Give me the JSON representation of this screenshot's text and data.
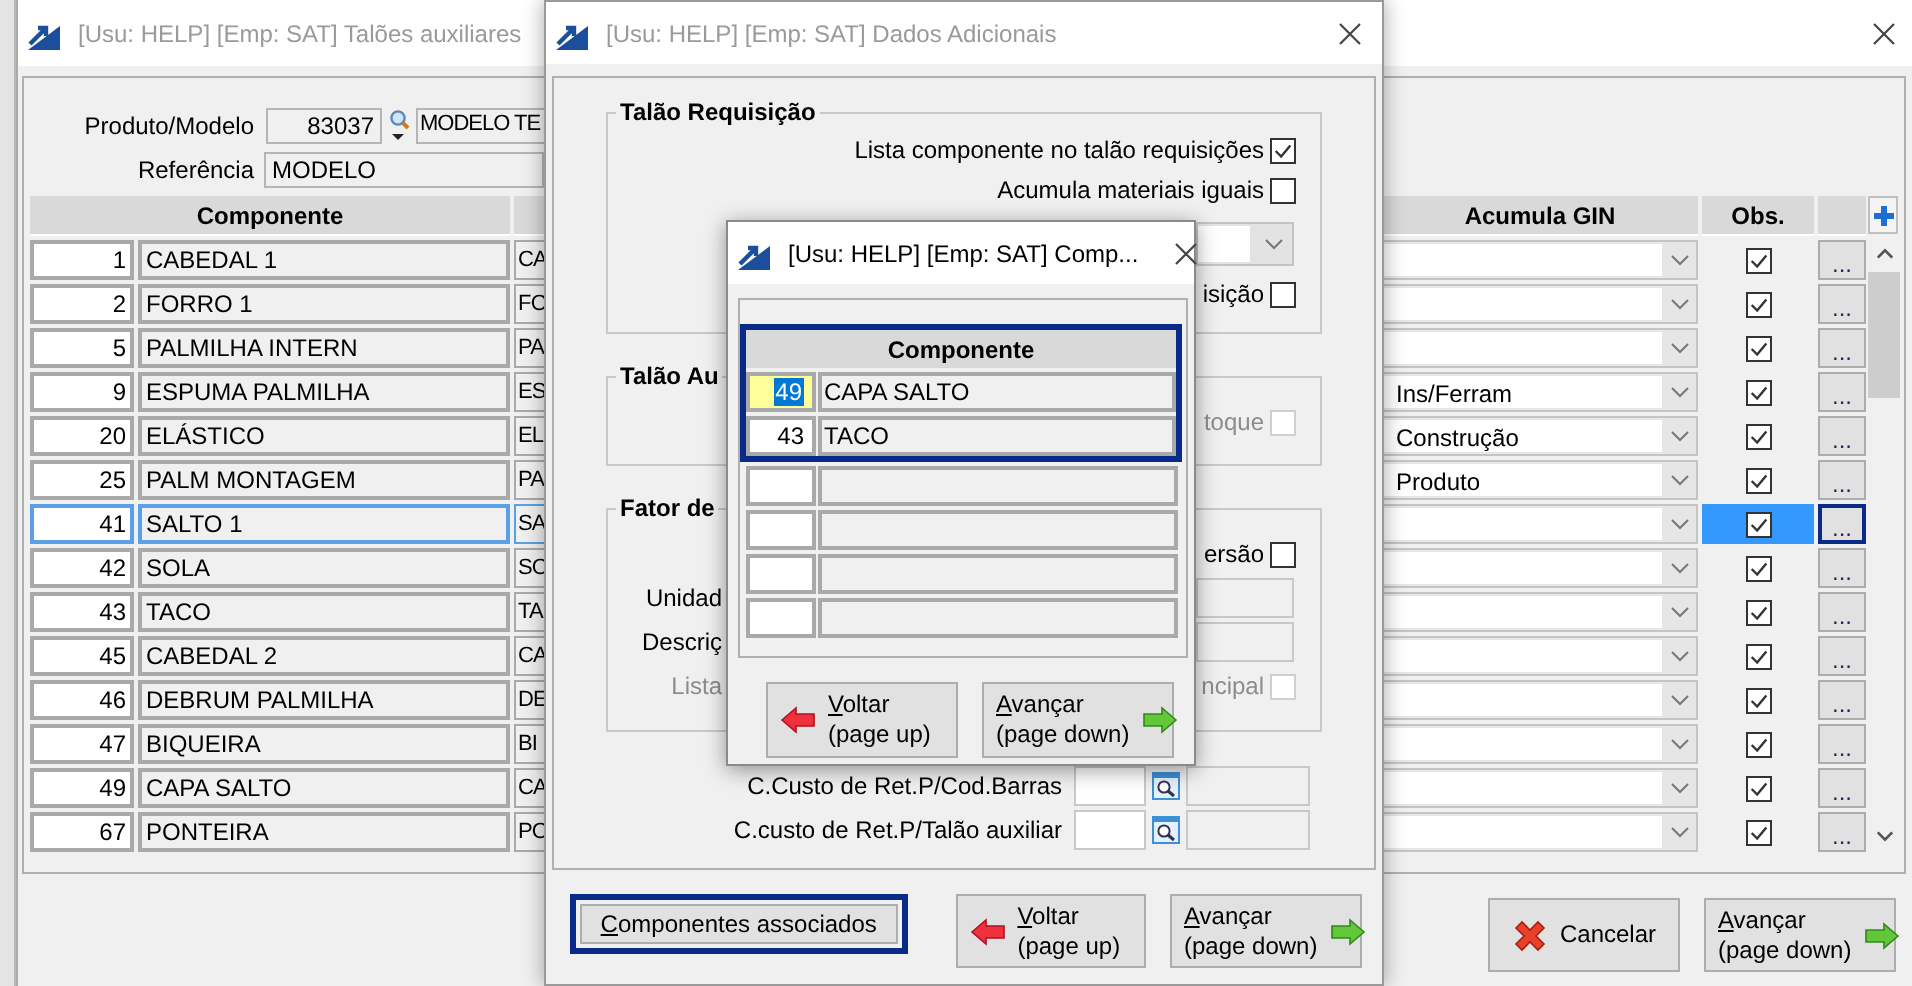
{
  "main_window": {
    "title": "[Usu: HELP] [Emp: SAT] Talões auxiliares",
    "active": false,
    "product": {
      "label": "Produto/Modelo",
      "code": "83037",
      "description": "MODELO TE"
    },
    "reference": {
      "label": "Referência",
      "value": "MODELO"
    },
    "table": {
      "columns": [
        "Componente",
        "Acumula GIN",
        "Obs."
      ],
      "rows": [
        {
          "code": "1",
          "name": "CABEDAL 1",
          "column_3": "CA",
          "obs": true,
          "button": "...",
          "selected": false
        },
        {
          "code": "2",
          "name": "FORRO 1",
          "column_3": "FO",
          "obs": true,
          "button": "...",
          "selected": false
        },
        {
          "code": "5",
          "name": "PALMILHA INTERN",
          "column_3": "PA",
          "obs": true,
          "button": "...",
          "selected": false
        },
        {
          "code": "9",
          "name": "ESPUMA PALMILHA",
          "column_3": "ES",
          "acumula_gin": "Ins/Ferram",
          "obs": true,
          "button": "...",
          "selected": false
        },
        {
          "code": "20",
          "name": "ELÁSTICO",
          "column_3": "EL",
          "acumula_gin": "Construção",
          "obs": true,
          "button": "...",
          "selected": false
        },
        {
          "code": "25",
          "name": "PALM MONTAGEM",
          "column_3": "PA",
          "acumula_gin": "Produto",
          "obs": true,
          "button": "...",
          "selected": false
        },
        {
          "code": "41",
          "name": "SALTO 1",
          "column_3": "SA",
          "obs": true,
          "button": "...",
          "selected": true
        },
        {
          "code": "42",
          "name": "SOLA",
          "column_3": "SO",
          "obs": true,
          "button": "...",
          "selected": false
        },
        {
          "code": "43",
          "name": "TACO",
          "column_3": "TA",
          "obs": true,
          "button": "...",
          "selected": false
        },
        {
          "code": "45",
          "name": "CABEDAL 2",
          "column_3": "CA",
          "obs": true,
          "button": "...",
          "selected": false
        },
        {
          "code": "46",
          "name": "DEBRUM PALMILHA",
          "column_3": "DE",
          "obs": true,
          "button": "...",
          "selected": false
        },
        {
          "code": "47",
          "name": "BIQUEIRA",
          "column_3": "BI",
          "obs": true,
          "button": "...",
          "selected": false
        },
        {
          "code": "49",
          "name": "CAPA SALTO",
          "column_3": "CA",
          "obs": true,
          "button": "...",
          "selected": false
        },
        {
          "code": "67",
          "name": "PONTEIRA",
          "column_3": "PO",
          "obs": true,
          "button": "...",
          "selected": false
        }
      ]
    },
    "buttons": [
      {
        "label": "Cancelar",
        "kind": "cancel",
        "mnemonic": false
      },
      {
        "label": "Avançar",
        "sublabel": "(page down)",
        "kind": "next",
        "mnemonic": true
      }
    ]
  },
  "details_window": {
    "title": "[Usu: HELP] [Emp: SAT] Dados Adicionais",
    "active": false,
    "groups": [
      {
        "title": "Talão Requisição",
        "rows": [
          {
            "kind": "checkbox",
            "label": "Lista componente no talão requisições",
            "checked": true,
            "disabled": false
          },
          {
            "kind": "checkbox",
            "label": "Acumula materiais iguais",
            "checked": false,
            "disabled": false
          },
          {
            "kind": "dropdown"
          },
          {
            "kind": "checkbox",
            "label": "isição",
            "checked": false,
            "disabled": false
          }
        ]
      },
      {
        "title": "Talão Au",
        "rows": [
          {
            "kind": "checkbox",
            "label": "toque",
            "checked": false,
            "disabled": true
          }
        ]
      },
      {
        "title": "Fator de",
        "rows": [
          {
            "kind": "checkbox",
            "label": "ersão",
            "checked": false,
            "disabled": false
          },
          {
            "kind": "field",
            "label": "Unidad"
          },
          {
            "kind": "field",
            "label": "Descriç"
          },
          {
            "kind": "checkbox",
            "label_left": "Lista",
            "label": "ncipal",
            "checked": false,
            "disabled": true
          }
        ]
      }
    ],
    "cost_fields": [
      {
        "label": "C.Custo de Ret.P/Cod.Barras"
      },
      {
        "label": "C.custo de Ret.P/Talão auxiliar"
      }
    ],
    "buttons": [
      {
        "label": "Componentes associados",
        "kind": "plain",
        "mnemonic": true,
        "focused": true
      },
      {
        "label": "Voltar",
        "sublabel": "(page up)",
        "kind": "back",
        "mnemonic": true,
        "focused": false
      },
      {
        "label": "Avançar",
        "sublabel": "(page down)",
        "kind": "next",
        "mnemonic": true,
        "focused": false
      }
    ]
  },
  "components_dialog": {
    "title": "[Usu: HELP] [Emp: SAT] Comp...",
    "active": true,
    "table": {
      "column": "Componente",
      "rows": [
        {
          "code": "49",
          "name": "CAPA SALTO",
          "selected": true
        },
        {
          "code": "43",
          "name": "TACO",
          "selected": false
        }
      ]
    },
    "buttons": [
      {
        "label": "Voltar",
        "sublabel": "(page up)",
        "kind": "back",
        "mnemonic": true
      },
      {
        "label": "Avançar",
        "sublabel": "(page down)",
        "kind": "next",
        "mnemonic": true
      }
    ]
  }
}
